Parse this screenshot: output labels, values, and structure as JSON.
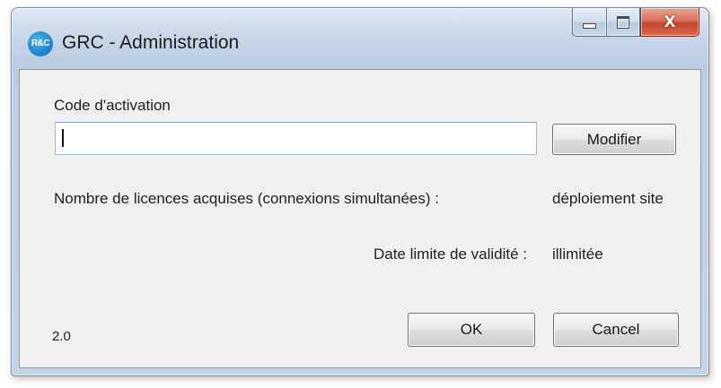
{
  "window": {
    "title": "GRC - Administration",
    "icon": {
      "name": "rc-logo-icon",
      "text": "R&C"
    },
    "caption_buttons": {
      "minimize": "minimize-icon",
      "maximize": "maximize-icon",
      "close": "close-icon",
      "close_glyph": "X"
    }
  },
  "activation": {
    "label": "Code d'activation",
    "input_value": "",
    "input_placeholder": "",
    "modify_button": "Modifier"
  },
  "licenses": {
    "label": "Nombre de licences acquises (connexions simultanées) :",
    "value": "déploiement site"
  },
  "validity": {
    "label": "Date limite de validité :",
    "value": "illimitée"
  },
  "footer": {
    "version": "2.0",
    "ok_button": "OK",
    "cancel_button": "Cancel"
  },
  "colors": {
    "title_bar": "#c9d8ea",
    "close_button": "#c5452b",
    "client_background": "#f0f0f0"
  }
}
